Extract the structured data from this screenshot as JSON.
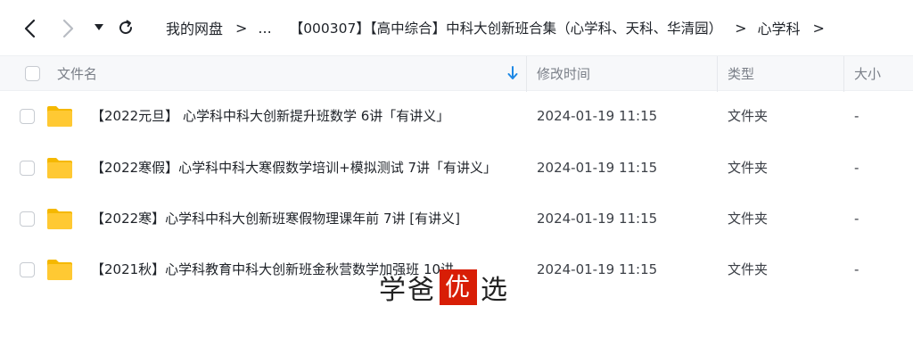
{
  "breadcrumb": {
    "items": [
      "我的网盘",
      "...",
      "【000307】【高中综合】中科大创新班合集（心学科、天科、华清园）",
      "心学科"
    ],
    "separator": ">"
  },
  "table": {
    "headers": {
      "name": "文件名",
      "modified": "修改时间",
      "type": "类型",
      "size": "大小"
    },
    "rows": [
      {
        "name": "【2022元旦】 心学科中科大创新提升班数学 6讲「有讲义」",
        "modified": "2024-01-19 11:15",
        "type": "文件夹",
        "size": "-"
      },
      {
        "name": "【2022寒假】心学科中科大寒假数学培训+模拟测试 7讲「有讲义」",
        "modified": "2024-01-19 11:15",
        "type": "文件夹",
        "size": "-"
      },
      {
        "name": "【2022寒】心学科中科大创新班寒假物理课年前 7讲 [有讲义]",
        "modified": "2024-01-19 11:15",
        "type": "文件夹",
        "size": "-"
      },
      {
        "name": "【2021秋】心学科教育中科大创新班金秋营数学加强班 10讲",
        "modified": "2024-01-19 11:15",
        "type": "文件夹",
        "size": "-"
      }
    ]
  },
  "watermark": {
    "part1": "学爸",
    "part2": "优",
    "part3": "选"
  },
  "colors": {
    "folder": "#ffc933",
    "folder_dark": "#f5b800",
    "accent": "#1e88e5",
    "watermark_red": "#d81e06"
  }
}
